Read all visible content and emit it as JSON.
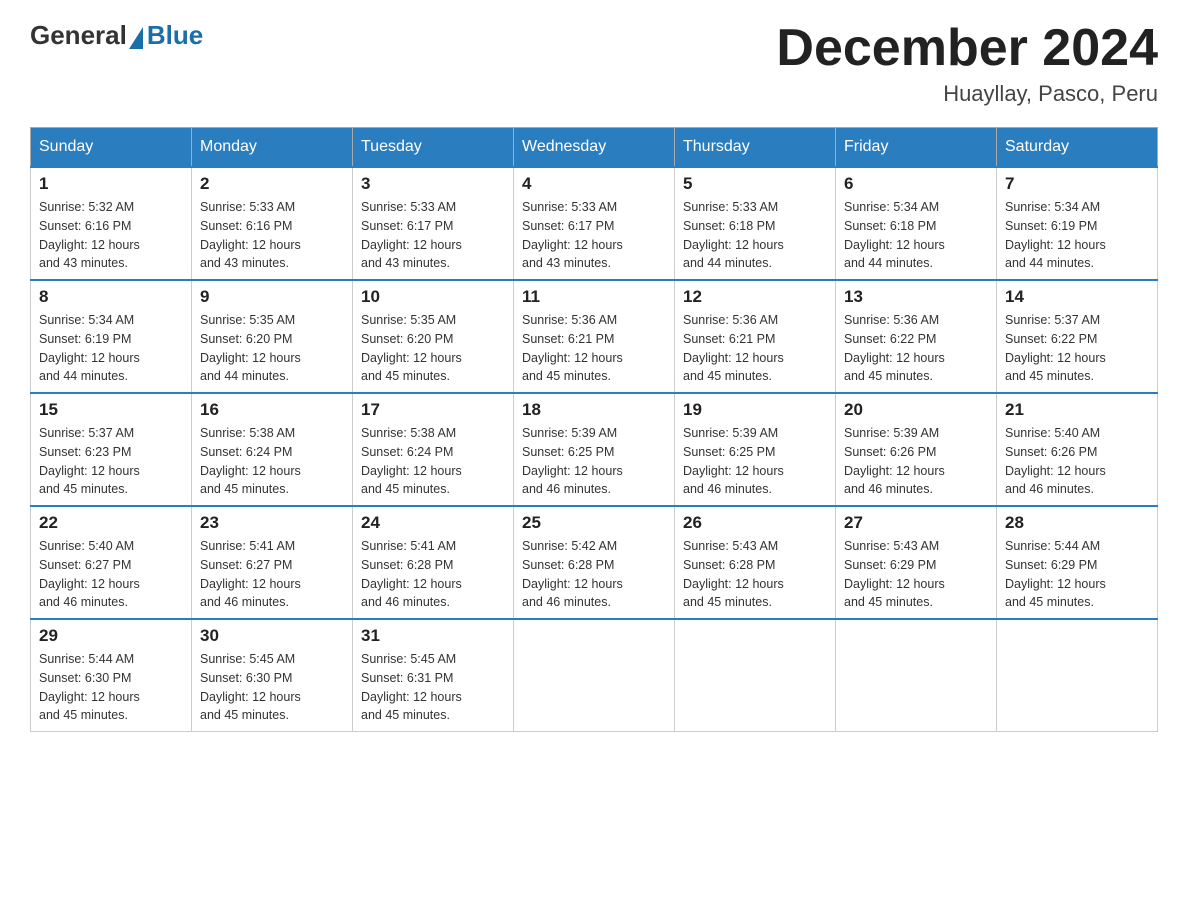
{
  "header": {
    "logo_general": "General",
    "logo_blue": "Blue",
    "month_title": "December 2024",
    "location": "Huayllay, Pasco, Peru"
  },
  "days_of_week": [
    "Sunday",
    "Monday",
    "Tuesday",
    "Wednesday",
    "Thursday",
    "Friday",
    "Saturday"
  ],
  "weeks": [
    [
      {
        "day": "1",
        "sunrise": "5:32 AM",
        "sunset": "6:16 PM",
        "daylight": "12 hours and 43 minutes."
      },
      {
        "day": "2",
        "sunrise": "5:33 AM",
        "sunset": "6:16 PM",
        "daylight": "12 hours and 43 minutes."
      },
      {
        "day": "3",
        "sunrise": "5:33 AM",
        "sunset": "6:17 PM",
        "daylight": "12 hours and 43 minutes."
      },
      {
        "day": "4",
        "sunrise": "5:33 AM",
        "sunset": "6:17 PM",
        "daylight": "12 hours and 43 minutes."
      },
      {
        "day": "5",
        "sunrise": "5:33 AM",
        "sunset": "6:18 PM",
        "daylight": "12 hours and 44 minutes."
      },
      {
        "day": "6",
        "sunrise": "5:34 AM",
        "sunset": "6:18 PM",
        "daylight": "12 hours and 44 minutes."
      },
      {
        "day": "7",
        "sunrise": "5:34 AM",
        "sunset": "6:19 PM",
        "daylight": "12 hours and 44 minutes."
      }
    ],
    [
      {
        "day": "8",
        "sunrise": "5:34 AM",
        "sunset": "6:19 PM",
        "daylight": "12 hours and 44 minutes."
      },
      {
        "day": "9",
        "sunrise": "5:35 AM",
        "sunset": "6:20 PM",
        "daylight": "12 hours and 44 minutes."
      },
      {
        "day": "10",
        "sunrise": "5:35 AM",
        "sunset": "6:20 PM",
        "daylight": "12 hours and 45 minutes."
      },
      {
        "day": "11",
        "sunrise": "5:36 AM",
        "sunset": "6:21 PM",
        "daylight": "12 hours and 45 minutes."
      },
      {
        "day": "12",
        "sunrise": "5:36 AM",
        "sunset": "6:21 PM",
        "daylight": "12 hours and 45 minutes."
      },
      {
        "day": "13",
        "sunrise": "5:36 AM",
        "sunset": "6:22 PM",
        "daylight": "12 hours and 45 minutes."
      },
      {
        "day": "14",
        "sunrise": "5:37 AM",
        "sunset": "6:22 PM",
        "daylight": "12 hours and 45 minutes."
      }
    ],
    [
      {
        "day": "15",
        "sunrise": "5:37 AM",
        "sunset": "6:23 PM",
        "daylight": "12 hours and 45 minutes."
      },
      {
        "day": "16",
        "sunrise": "5:38 AM",
        "sunset": "6:24 PM",
        "daylight": "12 hours and 45 minutes."
      },
      {
        "day": "17",
        "sunrise": "5:38 AM",
        "sunset": "6:24 PM",
        "daylight": "12 hours and 45 minutes."
      },
      {
        "day": "18",
        "sunrise": "5:39 AM",
        "sunset": "6:25 PM",
        "daylight": "12 hours and 46 minutes."
      },
      {
        "day": "19",
        "sunrise": "5:39 AM",
        "sunset": "6:25 PM",
        "daylight": "12 hours and 46 minutes."
      },
      {
        "day": "20",
        "sunrise": "5:39 AM",
        "sunset": "6:26 PM",
        "daylight": "12 hours and 46 minutes."
      },
      {
        "day": "21",
        "sunrise": "5:40 AM",
        "sunset": "6:26 PM",
        "daylight": "12 hours and 46 minutes."
      }
    ],
    [
      {
        "day": "22",
        "sunrise": "5:40 AM",
        "sunset": "6:27 PM",
        "daylight": "12 hours and 46 minutes."
      },
      {
        "day": "23",
        "sunrise": "5:41 AM",
        "sunset": "6:27 PM",
        "daylight": "12 hours and 46 minutes."
      },
      {
        "day": "24",
        "sunrise": "5:41 AM",
        "sunset": "6:28 PM",
        "daylight": "12 hours and 46 minutes."
      },
      {
        "day": "25",
        "sunrise": "5:42 AM",
        "sunset": "6:28 PM",
        "daylight": "12 hours and 46 minutes."
      },
      {
        "day": "26",
        "sunrise": "5:43 AM",
        "sunset": "6:28 PM",
        "daylight": "12 hours and 45 minutes."
      },
      {
        "day": "27",
        "sunrise": "5:43 AM",
        "sunset": "6:29 PM",
        "daylight": "12 hours and 45 minutes."
      },
      {
        "day": "28",
        "sunrise": "5:44 AM",
        "sunset": "6:29 PM",
        "daylight": "12 hours and 45 minutes."
      }
    ],
    [
      {
        "day": "29",
        "sunrise": "5:44 AM",
        "sunset": "6:30 PM",
        "daylight": "12 hours and 45 minutes."
      },
      {
        "day": "30",
        "sunrise": "5:45 AM",
        "sunset": "6:30 PM",
        "daylight": "12 hours and 45 minutes."
      },
      {
        "day": "31",
        "sunrise": "5:45 AM",
        "sunset": "6:31 PM",
        "daylight": "12 hours and 45 minutes."
      },
      null,
      null,
      null,
      null
    ]
  ],
  "labels": {
    "sunrise": "Sunrise:",
    "sunset": "Sunset:",
    "daylight": "Daylight:"
  }
}
